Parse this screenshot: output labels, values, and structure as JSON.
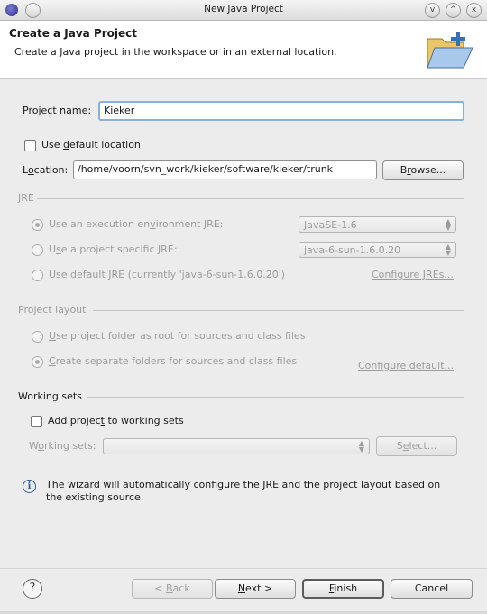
{
  "window": {
    "title": "New Java Project",
    "buttons": [
      "v",
      "^",
      "x"
    ]
  },
  "header": {
    "title": "Create a Java Project",
    "description": "Create a Java project in the workspace or in an external location."
  },
  "project_name": {
    "label": "Project name:",
    "value": "Kieker"
  },
  "use_default_location": {
    "label": "Use default location",
    "checked": false
  },
  "location": {
    "label": "Location:",
    "value": "/home/voorn/svn_work/kieker/software/kieker/trunk",
    "browse_label": "Browse..."
  },
  "jre": {
    "group_label": "JRE",
    "option_env": {
      "label": "Use an execution environment JRE:",
      "selected": true,
      "combo_value": "JavaSE-1.6"
    },
    "option_specific": {
      "label": "Use a project specific JRE:",
      "selected": false,
      "combo_value": "java-6-sun-1.6.0.20"
    },
    "option_default": {
      "label": "Use default JRE (currently 'java-6-sun-1.6.0.20')",
      "selected": false
    },
    "configure_link": "Configure JREs..."
  },
  "layout": {
    "group_label": "Project layout",
    "option_root": {
      "label": "Use project folder as root for sources and class files",
      "selected": false
    },
    "option_separate": {
      "label": "Create separate folders for sources and class files",
      "selected": true
    },
    "configure_link": "Configure default..."
  },
  "working_sets": {
    "group_label": "Working sets",
    "add_label": "Add project to working sets",
    "add_checked": false,
    "sets_label": "Working sets:",
    "sets_value": "",
    "select_label": "Select..."
  },
  "info_message": {
    "line1": "The wizard will automatically configure the JRE and the project layout based on",
    "line2": "the existing source."
  },
  "footer": {
    "help_glyph": "?",
    "back_label": "< Back",
    "next_label": "Next >",
    "finish_label": "Finish",
    "cancel_label": "Cancel"
  }
}
